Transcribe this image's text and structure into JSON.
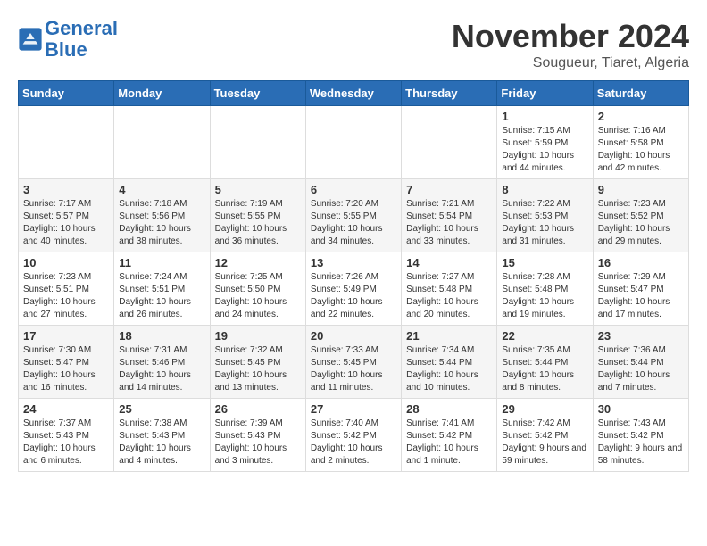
{
  "header": {
    "logo_line1": "General",
    "logo_line2": "Blue",
    "month": "November 2024",
    "location": "Sougueur, Tiaret, Algeria"
  },
  "weekdays": [
    "Sunday",
    "Monday",
    "Tuesday",
    "Wednesday",
    "Thursday",
    "Friday",
    "Saturday"
  ],
  "weeks": [
    [
      {
        "day": "",
        "info": ""
      },
      {
        "day": "",
        "info": ""
      },
      {
        "day": "",
        "info": ""
      },
      {
        "day": "",
        "info": ""
      },
      {
        "day": "",
        "info": ""
      },
      {
        "day": "1",
        "info": "Sunrise: 7:15 AM\nSunset: 5:59 PM\nDaylight: 10 hours and 44 minutes."
      },
      {
        "day": "2",
        "info": "Sunrise: 7:16 AM\nSunset: 5:58 PM\nDaylight: 10 hours and 42 minutes."
      }
    ],
    [
      {
        "day": "3",
        "info": "Sunrise: 7:17 AM\nSunset: 5:57 PM\nDaylight: 10 hours and 40 minutes."
      },
      {
        "day": "4",
        "info": "Sunrise: 7:18 AM\nSunset: 5:56 PM\nDaylight: 10 hours and 38 minutes."
      },
      {
        "day": "5",
        "info": "Sunrise: 7:19 AM\nSunset: 5:55 PM\nDaylight: 10 hours and 36 minutes."
      },
      {
        "day": "6",
        "info": "Sunrise: 7:20 AM\nSunset: 5:55 PM\nDaylight: 10 hours and 34 minutes."
      },
      {
        "day": "7",
        "info": "Sunrise: 7:21 AM\nSunset: 5:54 PM\nDaylight: 10 hours and 33 minutes."
      },
      {
        "day": "8",
        "info": "Sunrise: 7:22 AM\nSunset: 5:53 PM\nDaylight: 10 hours and 31 minutes."
      },
      {
        "day": "9",
        "info": "Sunrise: 7:23 AM\nSunset: 5:52 PM\nDaylight: 10 hours and 29 minutes."
      }
    ],
    [
      {
        "day": "10",
        "info": "Sunrise: 7:23 AM\nSunset: 5:51 PM\nDaylight: 10 hours and 27 minutes."
      },
      {
        "day": "11",
        "info": "Sunrise: 7:24 AM\nSunset: 5:51 PM\nDaylight: 10 hours and 26 minutes."
      },
      {
        "day": "12",
        "info": "Sunrise: 7:25 AM\nSunset: 5:50 PM\nDaylight: 10 hours and 24 minutes."
      },
      {
        "day": "13",
        "info": "Sunrise: 7:26 AM\nSunset: 5:49 PM\nDaylight: 10 hours and 22 minutes."
      },
      {
        "day": "14",
        "info": "Sunrise: 7:27 AM\nSunset: 5:48 PM\nDaylight: 10 hours and 20 minutes."
      },
      {
        "day": "15",
        "info": "Sunrise: 7:28 AM\nSunset: 5:48 PM\nDaylight: 10 hours and 19 minutes."
      },
      {
        "day": "16",
        "info": "Sunrise: 7:29 AM\nSunset: 5:47 PM\nDaylight: 10 hours and 17 minutes."
      }
    ],
    [
      {
        "day": "17",
        "info": "Sunrise: 7:30 AM\nSunset: 5:47 PM\nDaylight: 10 hours and 16 minutes."
      },
      {
        "day": "18",
        "info": "Sunrise: 7:31 AM\nSunset: 5:46 PM\nDaylight: 10 hours and 14 minutes."
      },
      {
        "day": "19",
        "info": "Sunrise: 7:32 AM\nSunset: 5:45 PM\nDaylight: 10 hours and 13 minutes."
      },
      {
        "day": "20",
        "info": "Sunrise: 7:33 AM\nSunset: 5:45 PM\nDaylight: 10 hours and 11 minutes."
      },
      {
        "day": "21",
        "info": "Sunrise: 7:34 AM\nSunset: 5:44 PM\nDaylight: 10 hours and 10 minutes."
      },
      {
        "day": "22",
        "info": "Sunrise: 7:35 AM\nSunset: 5:44 PM\nDaylight: 10 hours and 8 minutes."
      },
      {
        "day": "23",
        "info": "Sunrise: 7:36 AM\nSunset: 5:44 PM\nDaylight: 10 hours and 7 minutes."
      }
    ],
    [
      {
        "day": "24",
        "info": "Sunrise: 7:37 AM\nSunset: 5:43 PM\nDaylight: 10 hours and 6 minutes."
      },
      {
        "day": "25",
        "info": "Sunrise: 7:38 AM\nSunset: 5:43 PM\nDaylight: 10 hours and 4 minutes."
      },
      {
        "day": "26",
        "info": "Sunrise: 7:39 AM\nSunset: 5:43 PM\nDaylight: 10 hours and 3 minutes."
      },
      {
        "day": "27",
        "info": "Sunrise: 7:40 AM\nSunset: 5:42 PM\nDaylight: 10 hours and 2 minutes."
      },
      {
        "day": "28",
        "info": "Sunrise: 7:41 AM\nSunset: 5:42 PM\nDaylight: 10 hours and 1 minute."
      },
      {
        "day": "29",
        "info": "Sunrise: 7:42 AM\nSunset: 5:42 PM\nDaylight: 9 hours and 59 minutes."
      },
      {
        "day": "30",
        "info": "Sunrise: 7:43 AM\nSunset: 5:42 PM\nDaylight: 9 hours and 58 minutes."
      }
    ]
  ]
}
